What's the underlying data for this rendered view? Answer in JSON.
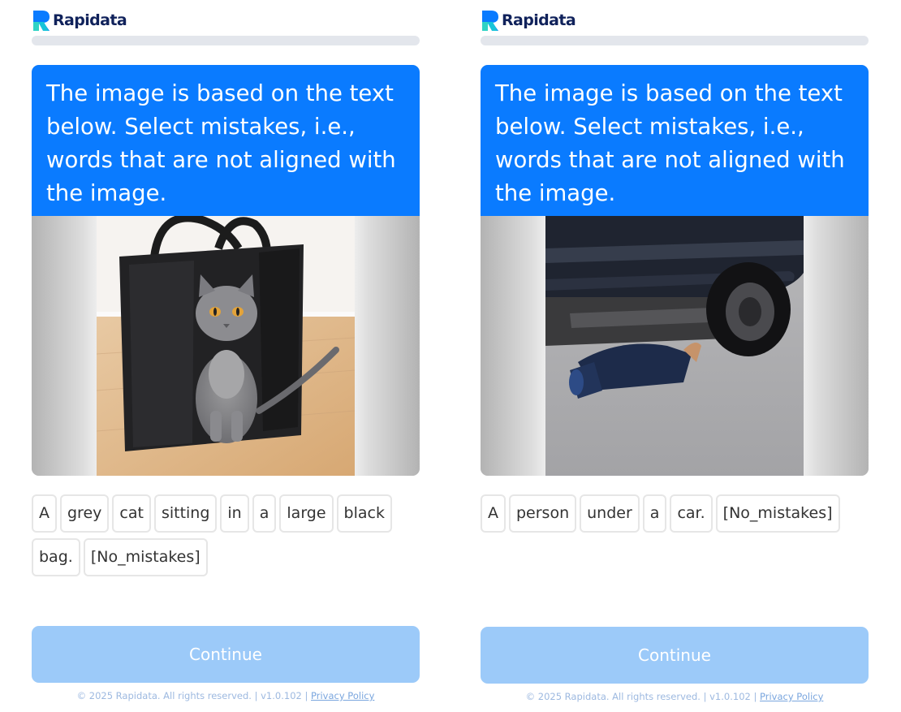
{
  "brand": {
    "name": "Rapidata",
    "accent": "#0a7bff",
    "continue_bg": "#9ccaf9"
  },
  "panels": [
    {
      "progress": 0.0,
      "prompt": "The image is based on the text below. Select mistakes, i.e., words that are not aligned with the image.",
      "image_subject": "grey cat sitting in front of a large black bag",
      "words": [
        "A",
        "grey",
        "cat",
        "sitting",
        "in",
        "a",
        "large",
        "black",
        "bag.",
        "[No_mistakes]"
      ],
      "continue_label": "Continue",
      "footer": {
        "text": "© 2025 Rapidata. All rights reserved. | v1.0.102 | ",
        "link": "Privacy Policy"
      }
    },
    {
      "progress": 0.0,
      "prompt": "The image is based on the text below. Select mistakes, i.e., words that are not aligned with the image.",
      "image_subject": "person lying under a car",
      "words": [
        "A",
        "person",
        "under",
        "a",
        "car.",
        "[No_mistakes]"
      ],
      "continue_label": "Continue",
      "footer": {
        "text": "© 2025 Rapidata. All rights reserved. | v1.0.102 | ",
        "link": "Privacy Policy"
      }
    }
  ]
}
